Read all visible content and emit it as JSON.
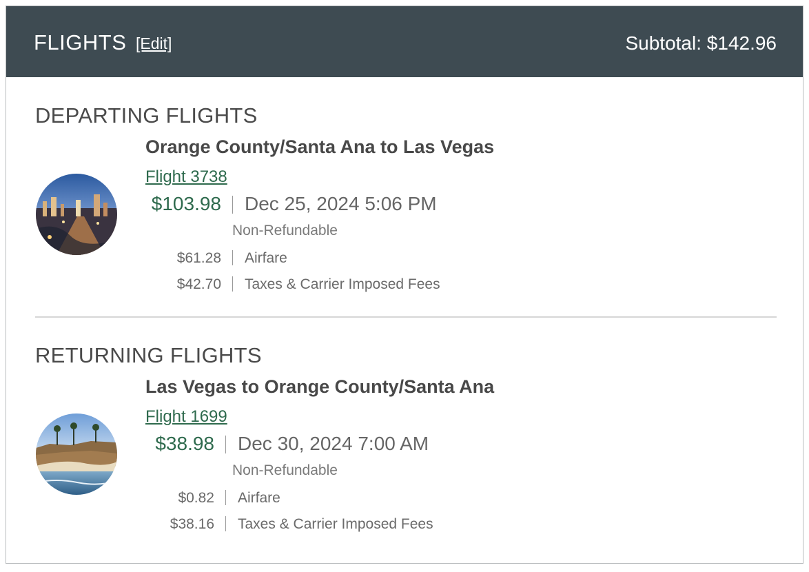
{
  "header": {
    "title": "FLIGHTS",
    "edit_label": "[Edit]",
    "subtotal": "Subtotal: $142.96"
  },
  "departing": {
    "section_title": "DEPARTING FLIGHTS",
    "route": "Orange County/Santa Ana to Las Vegas",
    "flight_link": "Flight 3738",
    "price": "$103.98",
    "datetime": "Dec 25, 2024 5:06 PM",
    "fare_note": "Non-Refundable",
    "breakdown": [
      {
        "amount": "$61.28",
        "label": "Airfare"
      },
      {
        "amount": "$42.70",
        "label": "Taxes & Carrier Imposed Fees"
      }
    ]
  },
  "returning": {
    "section_title": "RETURNING FLIGHTS",
    "route": "Las Vegas to Orange County/Santa Ana",
    "flight_link": "Flight 1699",
    "price": "$38.98",
    "datetime": "Dec 30, 2024 7:00 AM",
    "fare_note": "Non-Refundable",
    "breakdown": [
      {
        "amount": "$0.82",
        "label": "Airfare"
      },
      {
        "amount": "$38.16",
        "label": "Taxes & Carrier Imposed Fees"
      }
    ]
  },
  "colors": {
    "header_bg": "#3e4b52",
    "price_green": "#2e6a4d",
    "text_gray": "#666666"
  }
}
